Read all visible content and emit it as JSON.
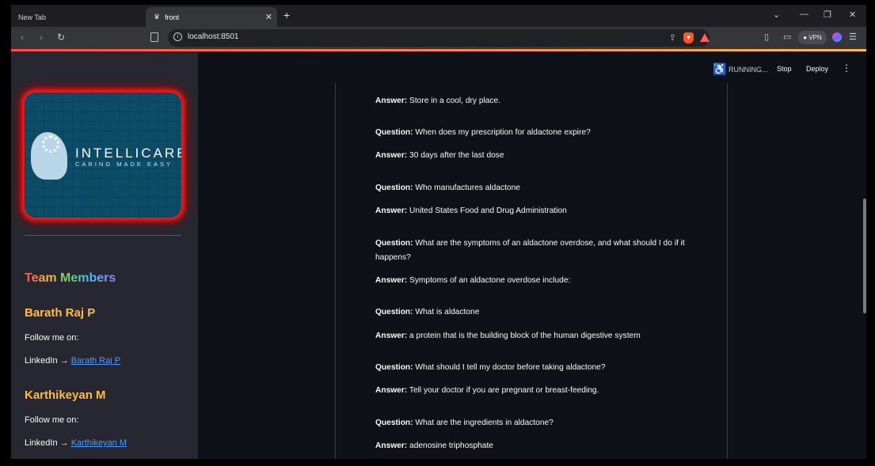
{
  "browser": {
    "tabs": [
      {
        "title": "New Tab"
      },
      {
        "title": "front",
        "favicon": "streamlit-icon"
      }
    ],
    "url": "localhost:8501",
    "vpn_label": "VPN"
  },
  "app_header": {
    "status": "RUNNING...",
    "stop_label": "Stop",
    "deploy_label": "Deploy"
  },
  "sidebar": {
    "logo": {
      "name": "INTELLICARE",
      "tagline": "CARING MADE EASY"
    },
    "team_heading": "Team Members",
    "members": [
      {
        "name": "Barath Raj P",
        "follow": "Follow me on:",
        "linkedin_prefix": "LinkedIn →",
        "linkedin_link": "Barath Raj P"
      },
      {
        "name": "Karthikeyan M",
        "follow": "Follow me on:",
        "linkedin_prefix": "LinkedIn →",
        "linkedin_link": "Karthikeyan M"
      }
    ]
  },
  "qa": {
    "question_label": "Question:",
    "answer_label": "Answer:",
    "lines": [
      {
        "kind": "answer",
        "text": "Store in a cool, dry place."
      },
      {
        "kind": "question",
        "text": "When does my prescription for aldactone expire?"
      },
      {
        "kind": "answer",
        "text": "30 days after the last dose"
      },
      {
        "kind": "question",
        "text": "Who manufactures aldactone"
      },
      {
        "kind": "answer",
        "text": "United States Food and Drug Administration"
      },
      {
        "kind": "question",
        "text": "What are the symptoms of an aldactone overdose, and what should I do if it happens?"
      },
      {
        "kind": "answer",
        "text": "Symptoms of an aldactone overdose include:"
      },
      {
        "kind": "question",
        "text": "What is aldactone"
      },
      {
        "kind": "answer",
        "text": "a protein that is the building block of the human digestive system"
      },
      {
        "kind": "question",
        "text": "What should I tell my doctor before taking aldactone?"
      },
      {
        "kind": "answer",
        "text": "Tell your doctor if you are pregnant or breast-feeding."
      },
      {
        "kind": "question",
        "text": "What are the ingredients in aldactone?"
      },
      {
        "kind": "answer",
        "text": "adenosine triphosphate"
      }
    ]
  },
  "colors": {
    "accent_red": "#ff4b4b",
    "member_name": "#ffbd45",
    "link": "#4b9cff",
    "logo_bg": "#0d4c66"
  }
}
